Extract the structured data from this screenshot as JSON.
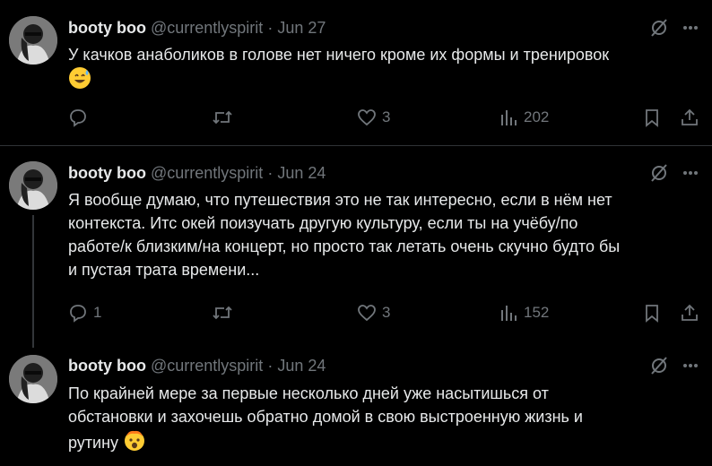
{
  "tweets": [
    {
      "author_name": "booty boo",
      "handle": "@currentlyspirit",
      "separator": "·",
      "date": "Jun 27",
      "text": "У качков анаболиков в голове нет ничего кроме их формы и тренировок",
      "emoji": "😅",
      "replies": "",
      "retweets": "",
      "likes": "3",
      "views": "202"
    },
    {
      "author_name": "booty boo",
      "handle": "@currentlyspirit",
      "separator": "·",
      "date": "Jun 24",
      "text_lines": [
        "Я вообще думаю, что путешествия это не так интересно, если в нём нет",
        "контекста. Итс окей поизучать другую культуру, если ты на учёбу/по",
        "работе/к близким/на концерт, но просто так летать очень скучно будто бы",
        "и пустая трата времени..."
      ],
      "replies": "1",
      "retweets": "",
      "likes": "3",
      "views": "152"
    },
    {
      "author_name": "booty boo",
      "handle": "@currentlyspirit",
      "separator": "·",
      "date": "Jun 24",
      "text_lines": [
        "По крайней мере за первые несколько дней уже насытишься от",
        "обстановки и захочешь обратно домой в свою выстроенную жизнь и",
        "рутину"
      ],
      "emoji": "🤯"
    }
  ],
  "colors": {
    "background": "#000000",
    "text": "#e7e9ea",
    "muted": "#71767b",
    "divider": "#2f3336"
  }
}
